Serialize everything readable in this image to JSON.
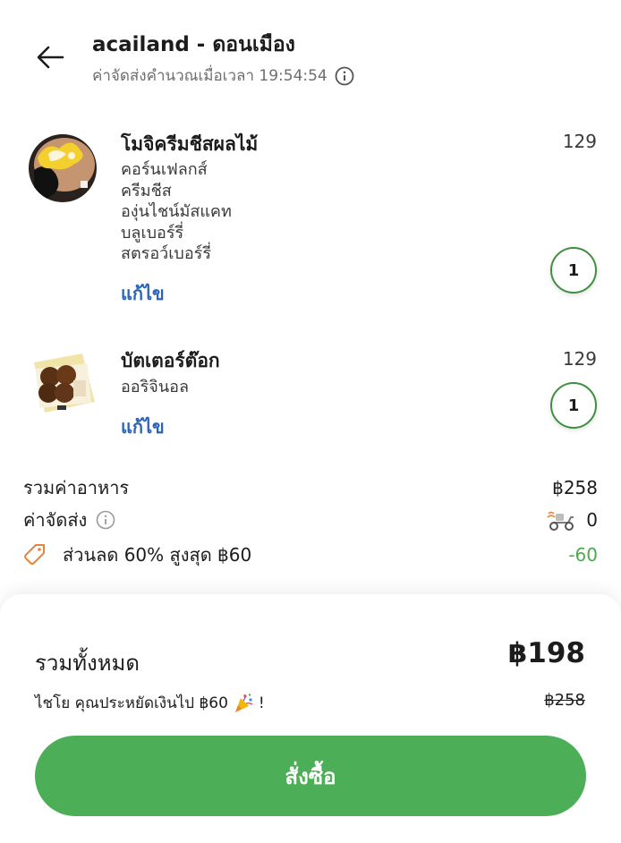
{
  "header": {
    "title": "acailand - ดอนเมือง",
    "subtitle": "ค่าจัดส่งคำนวณเมื่อเวลา 19:54:54"
  },
  "items": [
    {
      "name": "โมจิครีมชีสผลไม้",
      "price": "129",
      "options": [
        "คอร์นเฟลกส์",
        "ครีมชีส",
        "องุ่นไชน์มัสแคท",
        "บลูเบอร์รี่",
        "สตรอว์เบอร์รี่"
      ],
      "edit_label": "แก้ไข",
      "quantity": "1"
    },
    {
      "name": "บัตเตอร์ต๊อก",
      "price": "129",
      "options": [
        "ออริจินอล"
      ],
      "edit_label": "แก้ไข",
      "quantity": "1"
    }
  ],
  "summary": {
    "food_total_label": "รวมค่าอาหาร",
    "food_total_value": "฿258",
    "delivery_label": "ค่าจัดส่ง",
    "delivery_value": "0",
    "discount_label": "ส่วนลด 60% สูงสุด ฿60",
    "discount_value": "-60"
  },
  "checkout": {
    "total_label": "รวมทั้งหมด",
    "total_value": "฿198",
    "saving_text": "ไชโย คุณประหยัดเงินไป  ฿60",
    "saving_suffix": "!",
    "original_total": "฿258",
    "order_button": "สั่งซื้อ"
  },
  "colors": {
    "accent_green": "#4caf57",
    "link_blue": "#2b63b8",
    "discount_green": "#4caa4f",
    "tag_orange": "#e8833a"
  },
  "icons": {
    "back": "arrow-left-icon",
    "info": "info-icon",
    "delivery": "scooter-icon",
    "discount": "tag-icon",
    "celebrate": "party-popper-icon"
  }
}
